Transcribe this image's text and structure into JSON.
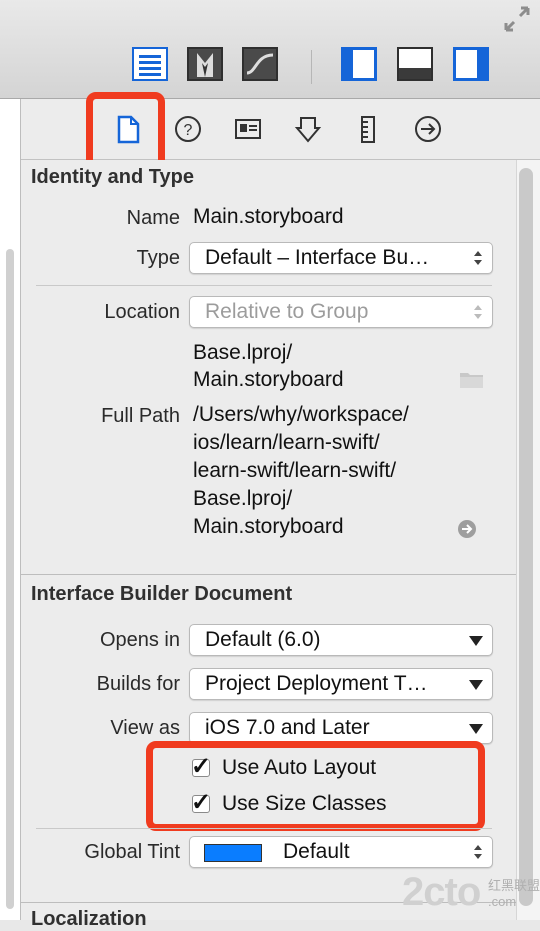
{
  "colors": {
    "accent": "#1565d8",
    "highlight_box": "#f03b1f",
    "tint_swatch": "#0a7dff"
  },
  "toolbar": {
    "icons": [
      "expand-icon",
      "list-view-icon",
      "tuxedo-icon",
      "curve-icon",
      "left-panel-icon",
      "bottom-panel-icon",
      "right-panel-icon"
    ]
  },
  "inspector_tabs": [
    "file-inspector-icon",
    "quick-help-icon",
    "identity-inspector-icon",
    "attributes-inspector-icon",
    "size-inspector-icon",
    "connections-inspector-icon"
  ],
  "identity": {
    "title": "Identity and Type",
    "name_label": "Name",
    "name_value": "Main.storyboard",
    "type_label": "Type",
    "type_value": "Default – Interface Bu…",
    "location_label": "Location",
    "location_value": "Relative to Group",
    "location_path": [
      "Base.lproj/",
      "Main.storyboard"
    ],
    "fullpath_label": "Full Path",
    "fullpath_value": [
      "/Users/why/workspace/",
      "ios/learn/learn-swift/",
      "learn-swift/learn-swift/",
      "Base.lproj/",
      "Main.storyboard"
    ]
  },
  "ib_document": {
    "title": "Interface Builder Document",
    "opens_in_label": "Opens in",
    "opens_in_value": "Default (6.0)",
    "builds_for_label": "Builds for",
    "builds_for_value": "Project Deployment T…",
    "view_as_label": "View as",
    "view_as_value": "iOS 7.0 and Later",
    "use_auto_layout": {
      "label": "Use Auto Layout",
      "checked": true
    },
    "use_size_classes": {
      "label": "Use Size Classes",
      "checked": true
    },
    "global_tint_label": "Global Tint",
    "global_tint_value": "Default"
  },
  "localization": {
    "title": "Localization"
  },
  "watermark": {
    "text": "2cto",
    "suffix": "红黑联盟 .com"
  }
}
